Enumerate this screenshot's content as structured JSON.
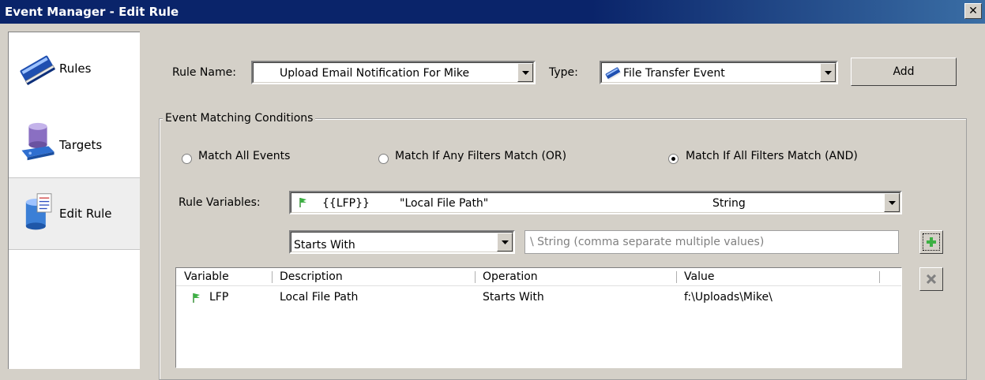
{
  "window": {
    "title": "Event Manager - Edit Rule",
    "close_glyph": "✕"
  },
  "sidebar": {
    "items": [
      {
        "label": "Rules",
        "icon": "book-icon",
        "selected": false
      },
      {
        "label": "Targets",
        "icon": "database-icon",
        "selected": false
      },
      {
        "label": "Edit Rule",
        "icon": "edit-rule-icon",
        "selected": true
      }
    ]
  },
  "form": {
    "rule_name_label": "Rule Name:",
    "rule_name_value": "Upload Email Notification For Mike",
    "type_label": "Type:",
    "type_value": "File Transfer Event",
    "add_label": "Add"
  },
  "conditions": {
    "group_title": "Event Matching Conditions",
    "radios": [
      {
        "label": "Match All Events",
        "checked": false
      },
      {
        "label": "Match If Any Filters Match (OR)",
        "checked": false
      },
      {
        "label": "Match If All Filters Match (AND)",
        "checked": true
      }
    ],
    "rule_variables_label": "Rule Variables:",
    "rule_variable": {
      "token": "{{LFP}}",
      "description": "\"Local File Path\"",
      "type": "String"
    },
    "operation_value": "Starts With",
    "value_placeholder": "\\ String (comma separate multiple values)",
    "table": {
      "headers": [
        "Variable",
        "Description",
        "Operation",
        "Value"
      ],
      "rows": [
        {
          "variable": "LFP",
          "description": "Local File Path",
          "operation": "Starts With",
          "value": "f:\\Uploads\\Mike\\"
        }
      ]
    }
  },
  "colors": {
    "titlebar": "#0a246a",
    "window_bg": "#d4d0c8",
    "flag_green": "#2e8b2e",
    "add_plus": "#3cb043"
  }
}
